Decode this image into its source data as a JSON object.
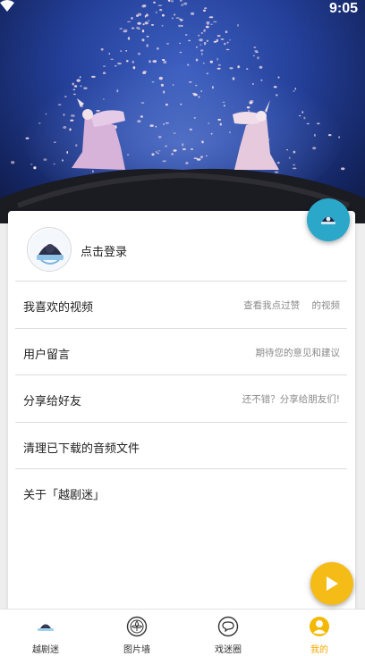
{
  "status_bar": {
    "time": "9:05",
    "wifi_icon": "wifi-icon"
  },
  "profile": {
    "login_label": "点击登录"
  },
  "menu": [
    {
      "title": "我喜欢的视频",
      "hint": "查看我点过赞    的视频"
    },
    {
      "title": "用户留言",
      "hint": "期待您的意见和建议"
    },
    {
      "title": "分享给好友",
      "hint": "还不错？分享给朋友们!"
    },
    {
      "title": "清理已下载的音频文件",
      "hint": ""
    },
    {
      "title": "关于「越剧迷」",
      "hint": ""
    }
  ],
  "nav": [
    {
      "label": "越剧迷",
      "icon": "opera-fan-logo-icon"
    },
    {
      "label": "图片墙",
      "icon": "flower-badge-icon"
    },
    {
      "label": "戏迷圈",
      "icon": "chat-bubble-icon"
    },
    {
      "label": "我的",
      "icon": "user-avatar-icon"
    }
  ],
  "colors": {
    "accent_teal": "#2aa7c9",
    "accent_yellow": "#f5bb16",
    "active_nav": "#f0a800"
  }
}
